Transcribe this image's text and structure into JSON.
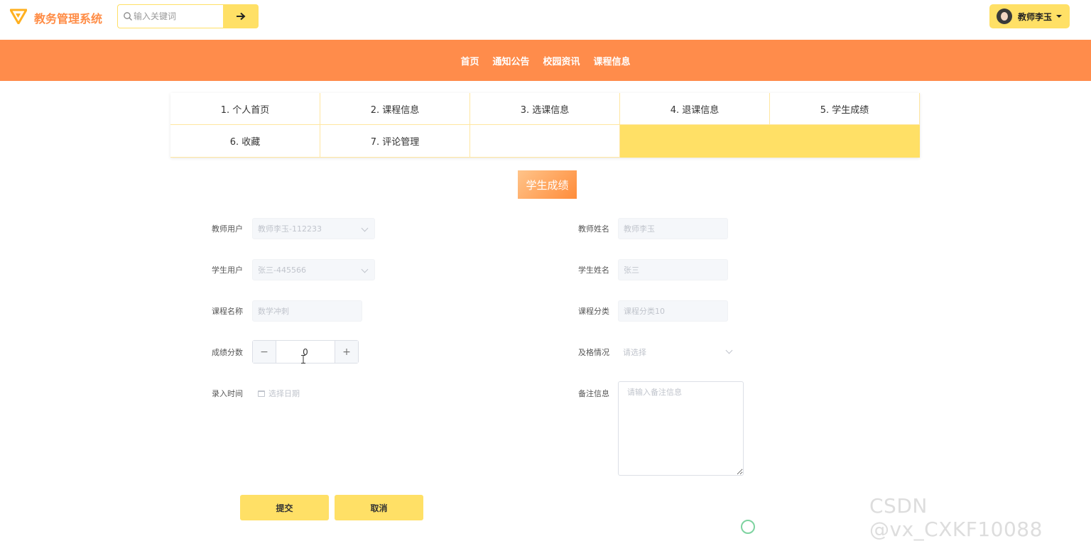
{
  "header": {
    "logo_text": "教务管理系统",
    "search_placeholder": "输入关键词",
    "user_name": "教师李玉",
    "brand_color": "#ff8c45",
    "accent_color": "#ffe066"
  },
  "nav": [
    "首页",
    "通知公告",
    "校园资讯",
    "课程信息"
  ],
  "menu": [
    "1. 个人首页",
    "2. 课程信息",
    "3. 选课信息",
    "4. 退课信息",
    "5. 学生成绩",
    "6. 收藏",
    "7. 评论管理"
  ],
  "page_title": "学生成绩",
  "form": {
    "teacher_user_label": "教师用户",
    "teacher_user_value": "教师李玉-112233",
    "teacher_name_label": "教师姓名",
    "teacher_name_value": "教师李玉",
    "student_user_label": "学生用户",
    "student_user_value": "张三-445566",
    "student_name_label": "学生姓名",
    "student_name_value": "张三",
    "course_name_label": "课程名称",
    "course_name_value": "数学冲刺",
    "course_category_label": "课程分类",
    "course_category_value": "课程分类10",
    "score_label": "成绩分数",
    "score_value": "0",
    "pass_label": "及格情况",
    "pass_placeholder": "请选择",
    "time_label": "录入时间",
    "time_placeholder": "选择日期",
    "remark_label": "备注信息",
    "remark_placeholder": "请输入备注信息"
  },
  "buttons": {
    "submit": "提交",
    "cancel": "取消"
  },
  "watermark": "CSDN @vx_CXKF10088"
}
